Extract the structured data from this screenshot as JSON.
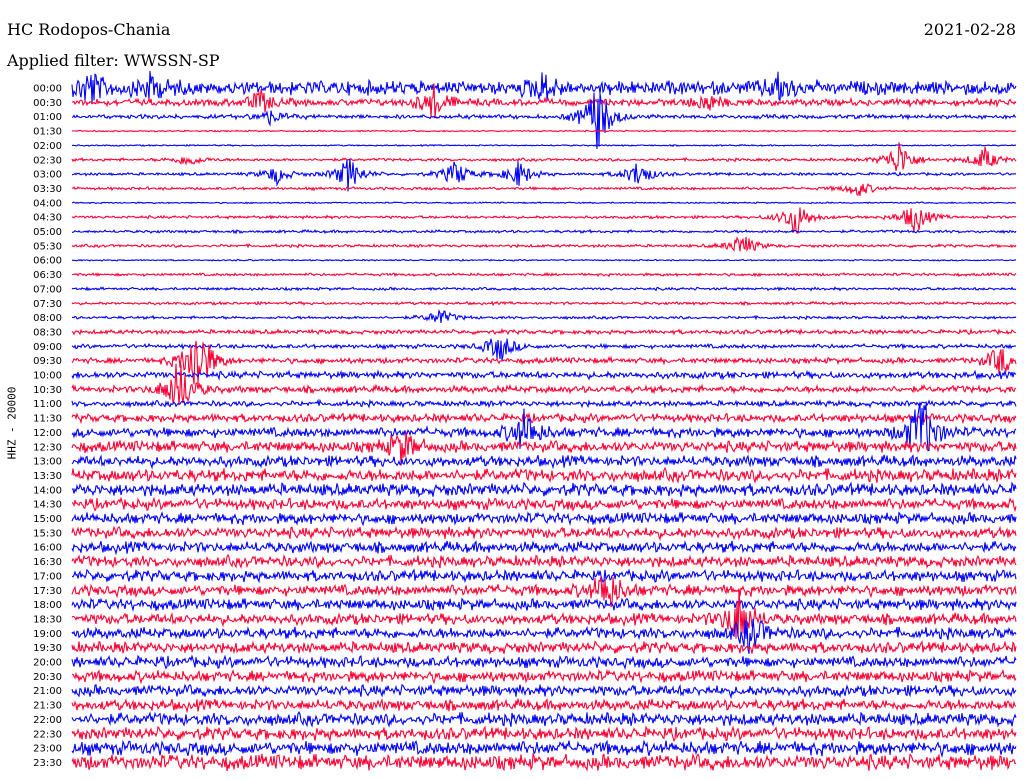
{
  "header": {
    "station": "HC Rodopos-Chania",
    "filter": "Applied filter: WWSSN-SP",
    "date": "2021-02-28",
    "channel": "HHZ - 20000"
  },
  "colors": {
    "trace_a": "#0000ff",
    "trace_b": "#ff0033",
    "text": "#000000"
  },
  "chart_data": {
    "type": "line",
    "title": "HC Rodopos-Chania",
    "subtitle": "Applied filter: WWSSN-SP",
    "ylabel": "HHZ - 20000",
    "row_minutes": 30,
    "row_labels": [
      "00:00",
      "00:30",
      "01:00",
      "01:30",
      "02:00",
      "02:30",
      "03:00",
      "03:30",
      "04:00",
      "04:30",
      "05:00",
      "05:30",
      "06:00",
      "06:30",
      "07:00",
      "07:30",
      "08:00",
      "08:30",
      "09:00",
      "09:30",
      "10:00",
      "10:30",
      "11:00",
      "11:30",
      "12:00",
      "12:30",
      "13:00",
      "13:30",
      "14:00",
      "14:30",
      "15:00",
      "15:30",
      "16:00",
      "16:30",
      "17:00",
      "17:30",
      "18:00",
      "18:30",
      "19:00",
      "19:30",
      "20:00",
      "20:30",
      "21:00",
      "21:30",
      "22:00",
      "22:30",
      "23:00",
      "23:30"
    ],
    "series_colors": [
      "trace_a",
      "trace_b"
    ],
    "noise_level": [
      10,
      5,
      3,
      1,
      1,
      2,
      2,
      2,
      1,
      2,
      2,
      2,
      1,
      2,
      2,
      2,
      2,
      3,
      3,
      4,
      5,
      5,
      4,
      6,
      7,
      8,
      8,
      9,
      9,
      8,
      8,
      8,
      8,
      8,
      8,
      8,
      8,
      8,
      8,
      8,
      8,
      8,
      8,
      8,
      9,
      9,
      10,
      11
    ],
    "events": [
      {
        "row": 0,
        "min": 0.6,
        "amp": 1.2
      },
      {
        "row": 0,
        "min": 2.5,
        "amp": 1.0
      },
      {
        "row": 0,
        "min": 15,
        "amp": 1.0
      },
      {
        "row": 0,
        "min": 22.5,
        "amp": 0.9
      },
      {
        "row": 1,
        "min": 6.0,
        "amp": 0.8
      },
      {
        "row": 1,
        "min": 11.5,
        "amp": 1.2
      },
      {
        "row": 1,
        "min": 20.2,
        "amp": 0.7
      },
      {
        "row": 2,
        "min": 16.7,
        "amp": 2.6
      },
      {
        "row": 2,
        "min": 6.3,
        "amp": 0.5
      },
      {
        "row": 5,
        "min": 3.7,
        "amp": 0.5
      },
      {
        "row": 5,
        "min": 26.3,
        "amp": 1.4
      },
      {
        "row": 5,
        "min": 29.0,
        "amp": 0.9
      },
      {
        "row": 6,
        "min": 6.5,
        "amp": 0.7
      },
      {
        "row": 6,
        "min": 8.8,
        "amp": 1.3
      },
      {
        "row": 6,
        "min": 12.2,
        "amp": 1.0
      },
      {
        "row": 6,
        "min": 14.2,
        "amp": 1.0
      },
      {
        "row": 6,
        "min": 18.0,
        "amp": 1.0
      },
      {
        "row": 7,
        "min": 25.0,
        "amp": 0.6
      },
      {
        "row": 9,
        "min": 23.0,
        "amp": 1.4
      },
      {
        "row": 9,
        "min": 26.8,
        "amp": 1.2
      },
      {
        "row": 11,
        "min": 21.3,
        "amp": 0.9
      },
      {
        "row": 16,
        "min": 11.7,
        "amp": 0.6
      },
      {
        "row": 18,
        "min": 13.6,
        "amp": 1.1
      },
      {
        "row": 19,
        "min": 29.5,
        "amp": 1.1
      },
      {
        "row": 19,
        "min": 4.0,
        "amp": 3.0
      },
      {
        "row": 21,
        "min": 3.4,
        "amp": 2.2
      },
      {
        "row": 24,
        "min": 27.0,
        "amp": 2.8
      },
      {
        "row": 24,
        "min": 14.4,
        "amp": 1.6
      },
      {
        "row": 25,
        "min": 10.5,
        "amp": 1.2
      },
      {
        "row": 35,
        "min": 17.0,
        "amp": 1.6
      },
      {
        "row": 37,
        "min": 21.2,
        "amp": 2.0
      },
      {
        "row": 38,
        "min": 21.6,
        "amp": 1.4
      }
    ]
  }
}
